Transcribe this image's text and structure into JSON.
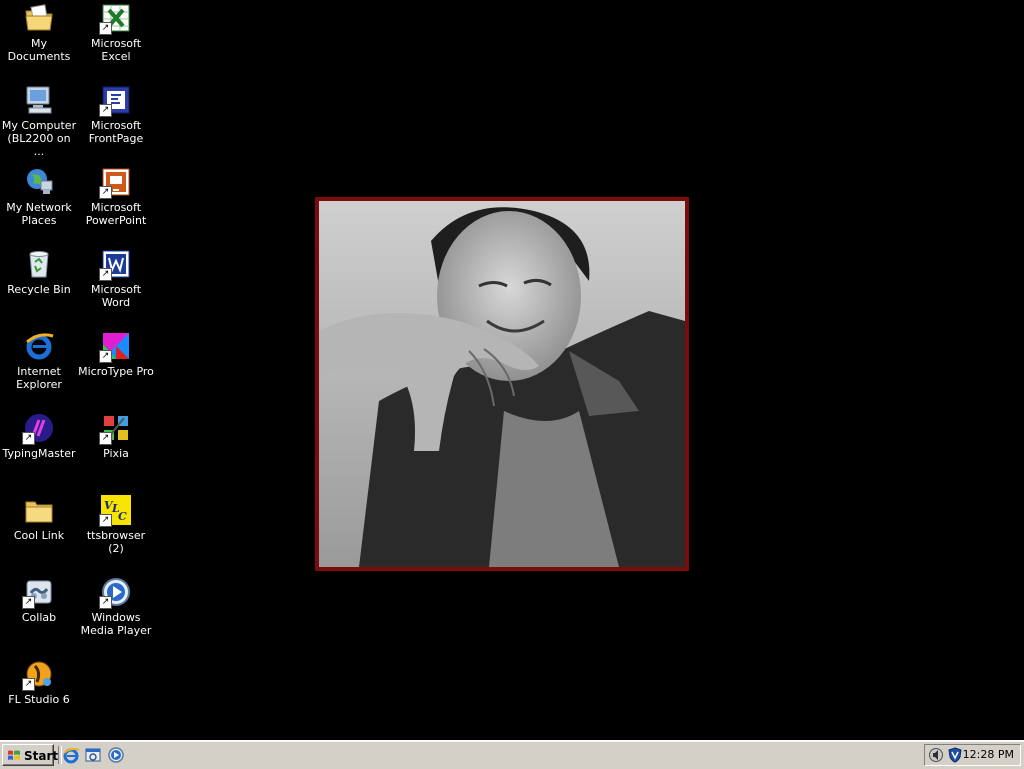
{
  "desktop": {
    "icons": [
      {
        "label": "My Documents",
        "icon": "folder-documents-icon"
      },
      {
        "label": "Microsoft Excel",
        "icon": "excel-icon"
      },
      {
        "label": "My Computer (BL2200 on ...",
        "icon": "computer-icon"
      },
      {
        "label": "Microsoft FrontPage",
        "icon": "frontpage-icon"
      },
      {
        "label": "My Network Places",
        "icon": "network-places-icon"
      },
      {
        "label": "Microsoft PowerPoint",
        "icon": "powerpoint-icon"
      },
      {
        "label": "Recycle Bin",
        "icon": "recycle-bin-icon"
      },
      {
        "label": "Microsoft Word",
        "icon": "word-icon"
      },
      {
        "label": "Internet Explorer",
        "icon": "internet-explorer-icon"
      },
      {
        "label": "MicroType Pro",
        "icon": "microtype-icon"
      },
      {
        "label": "TypingMaster",
        "icon": "typingmaster-icon"
      },
      {
        "label": "Pixia",
        "icon": "pixia-icon"
      },
      {
        "label": "Cool Link",
        "icon": "folder-icon"
      },
      {
        "label": "ttsbrowser (2)",
        "icon": "vlc-tts-icon"
      },
      {
        "label": "Collab",
        "icon": "collab-icon"
      },
      {
        "label": "Windows Media Player",
        "icon": "media-player-icon"
      },
      {
        "label": "FL Studio 6",
        "icon": "fl-studio-icon"
      }
    ],
    "wallpaper": {
      "frame_color": "#7a0c0c",
      "content": "grayscale portrait photo"
    }
  },
  "taskbar": {
    "start_label": "Start",
    "quick_launch": [
      "internet-explorer-icon",
      "show-desktop-icon",
      "media-player-icon"
    ],
    "tray_icons": [
      "speaker-icon",
      "shield-icon"
    ],
    "clock": "12:28 PM"
  },
  "colors": {
    "desktop_bg": "#000000",
    "taskbar_bg": "#d4d0c8",
    "frame": "#7a0c0c"
  }
}
